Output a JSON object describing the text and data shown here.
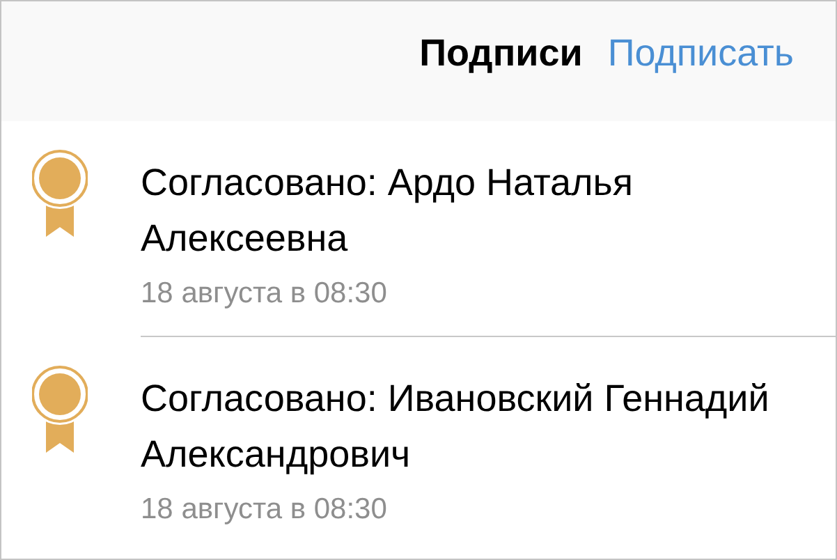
{
  "header": {
    "title": "Подписи",
    "action": "Подписать"
  },
  "signatures": [
    {
      "status": "Согласовано: Ардо Наталья Алексеевна",
      "date": "18 августа в 08:30"
    },
    {
      "status": "Согласовано: Ивановский Геннадий Александрович",
      "date": "18 августа в 08:30"
    }
  ]
}
